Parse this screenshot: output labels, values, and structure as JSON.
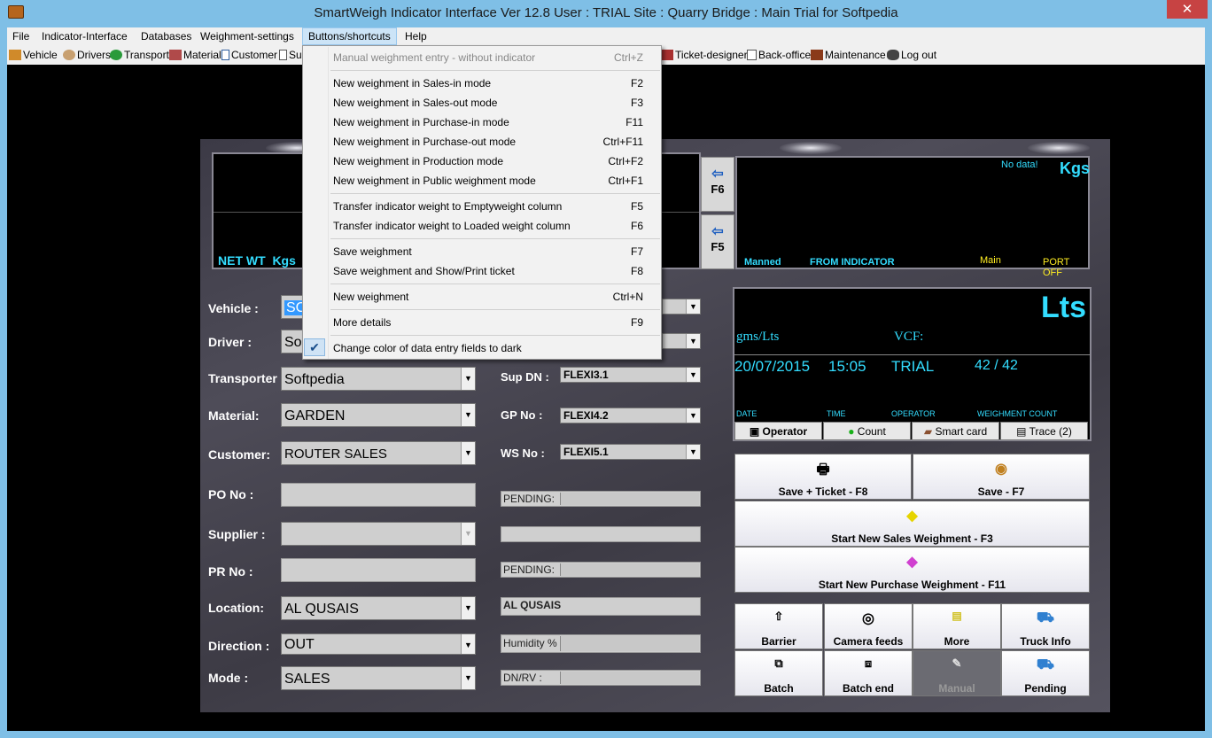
{
  "window": {
    "title": "SmartWeigh Indicator Interface Ver 12.8     User :  TRIAL          Site :  Quarry       Bridge :  Main      Trial for Softpedia",
    "close_glyph": "✕"
  },
  "menubar": [
    "File",
    "Indicator-Interface",
    "Databases",
    "Weighment-settings",
    "Buttons/shortcuts",
    "Help"
  ],
  "toolbar": {
    "left": [
      "Vehicle",
      "Drivers",
      "Transport",
      "Material",
      "Customer",
      "Su"
    ],
    "right": [
      "Ticket-designer",
      "Back-office",
      "Maintenance",
      "Log out"
    ]
  },
  "dropdown": {
    "items": [
      {
        "label": "Manual weighment entry - without indicator",
        "key": "Ctrl+Z",
        "disabled": true
      },
      {
        "label": "New weighment in Sales-in mode",
        "key": "F2"
      },
      {
        "label": "New weighment in Sales-out mode",
        "key": "F3"
      },
      {
        "label": "New weighment in Purchase-in mode",
        "key": "F11"
      },
      {
        "label": "New weighment in Purchase-out mode",
        "key": "Ctrl+F11"
      },
      {
        "label": "New weighment in Production mode",
        "key": "Ctrl+F2"
      },
      {
        "label": "New weighment in Public weighment mode",
        "key": "Ctrl+F1"
      },
      {
        "label": "Transfer indicator weight to Emptyweight column",
        "key": "F5"
      },
      {
        "label": "Transfer indicator weight to Loaded weight column",
        "key": "F6"
      },
      {
        "label": "Save weighment",
        "key": "F7"
      },
      {
        "label": "Save weighment and Show/Print ticket",
        "key": "F8"
      },
      {
        "label": "New weighment",
        "key": "Ctrl+N"
      },
      {
        "label": "More details",
        "key": "F9"
      },
      {
        "label": "Change color of data entry fields to dark",
        "key": "",
        "checked": true
      }
    ]
  },
  "display": {
    "net_wt": "NET WT",
    "kgs_small": "Kgs",
    "f6": "F6",
    "f5": "F5",
    "no_data": "No data!",
    "kgs": "Kgs",
    "manned": "Manned",
    "from_indicator": "FROM INDICATOR",
    "main": "Main",
    "port_off": "PORT OFF"
  },
  "info": {
    "unit": "Lts",
    "gms": "gms/Lts",
    "vcf": "VCF:",
    "date": "20/07/2015",
    "time": "15:05",
    "operator": "TRIAL",
    "count": "42 / 42",
    "h_date": "DATE",
    "h_time": "TIME",
    "h_operator": "OPERATOR",
    "h_count": "WEIGHMENT COUNT",
    "tabs": [
      "Operator",
      "Count",
      "Smart card",
      "Trace (2)"
    ]
  },
  "form": {
    "labels": {
      "vehicle": "Vehicle    :",
      "driver": "Driver     :",
      "transporter": "Transporter",
      "material": "Material:",
      "customer": "Customer:",
      "po": "PO No    :",
      "supplier": "Supplier  :",
      "pr": "PR No    :",
      "location": "Location:",
      "direction": "Direction :",
      "mode": "Mode     :",
      "sup_dn": "Sup DN :",
      "gp_no": "GP No  :",
      "ws_no": "WS No  :"
    },
    "values": {
      "vehicle": "SC",
      "driver": "So",
      "transporter": "Softpedia",
      "material": "GARDEN",
      "customer": "ROUTER SALES",
      "location": "AL QUSAIS",
      "direction": "OUT",
      "mode": "SALES",
      "sup_dn": "FLEXI3.1",
      "gp_no": "FLEXI4.2",
      "ws_no": "FLEXI5.1",
      "pending1": "PENDING:",
      "pending2": "PENDING:",
      "loc2": "AL QUSAIS",
      "humidity": "Humidity %",
      "dnrv": "DN/RV  :"
    }
  },
  "actions": {
    "save_ticket": "Save + Ticket - F8",
    "save": "Save - F7",
    "start_sales": "Start New Sales Weighment - F3",
    "start_purchase": "Start New Purchase Weighment - F11",
    "barrier": "Barrier",
    "camera": "Camera feeds",
    "more": "More",
    "truck_info": "Truck Info",
    "batch": "Batch",
    "batch_end": "Batch end",
    "manual": "Manual",
    "pending": "Pending"
  }
}
